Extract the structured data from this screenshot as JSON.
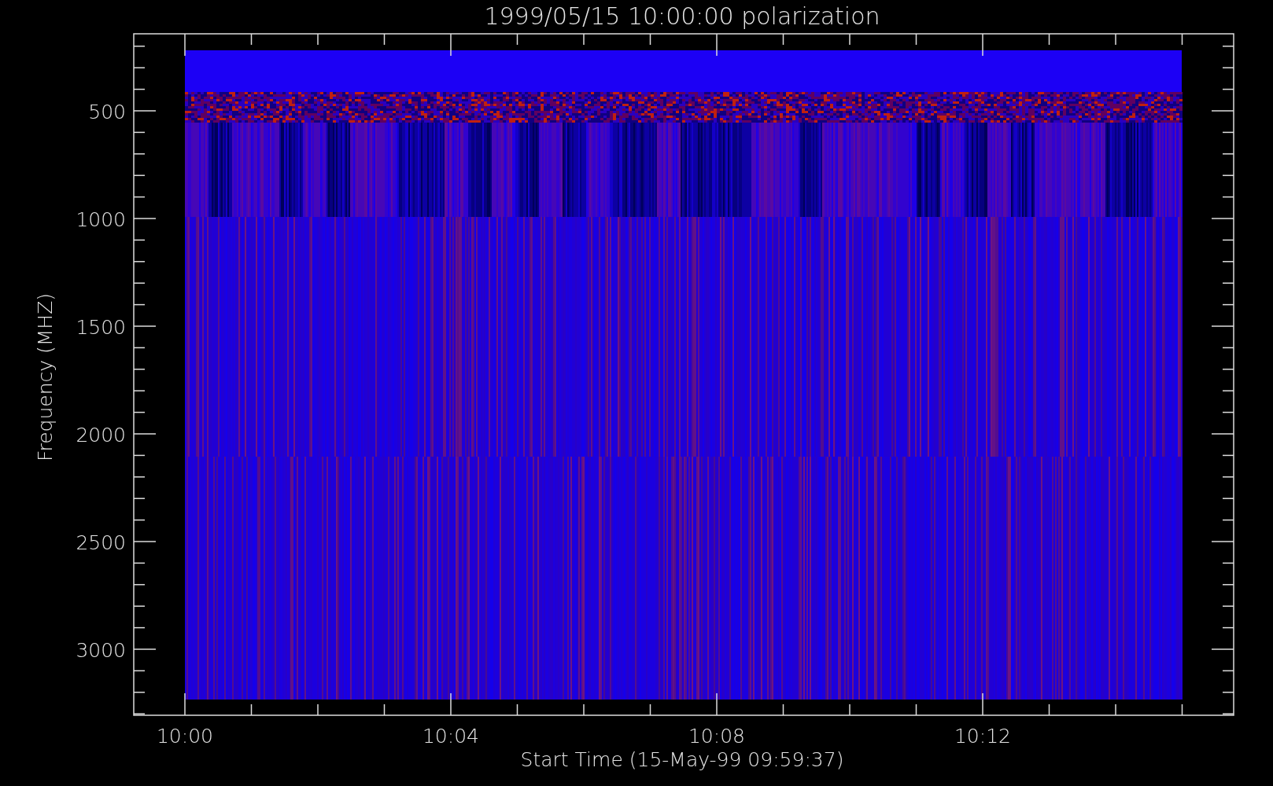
{
  "title": "1999/05/15 10:00:00 polarization",
  "x_axis": {
    "label": "Start Time (15-May-99 09:59:37)",
    "ticks": [
      "10:00",
      "10:04",
      "10:08",
      "10:12"
    ]
  },
  "y_axis": {
    "label": "Frequency (MHZ)",
    "ticks": [
      "500",
      "1000",
      "1500",
      "2000",
      "2500",
      "3000"
    ]
  }
}
